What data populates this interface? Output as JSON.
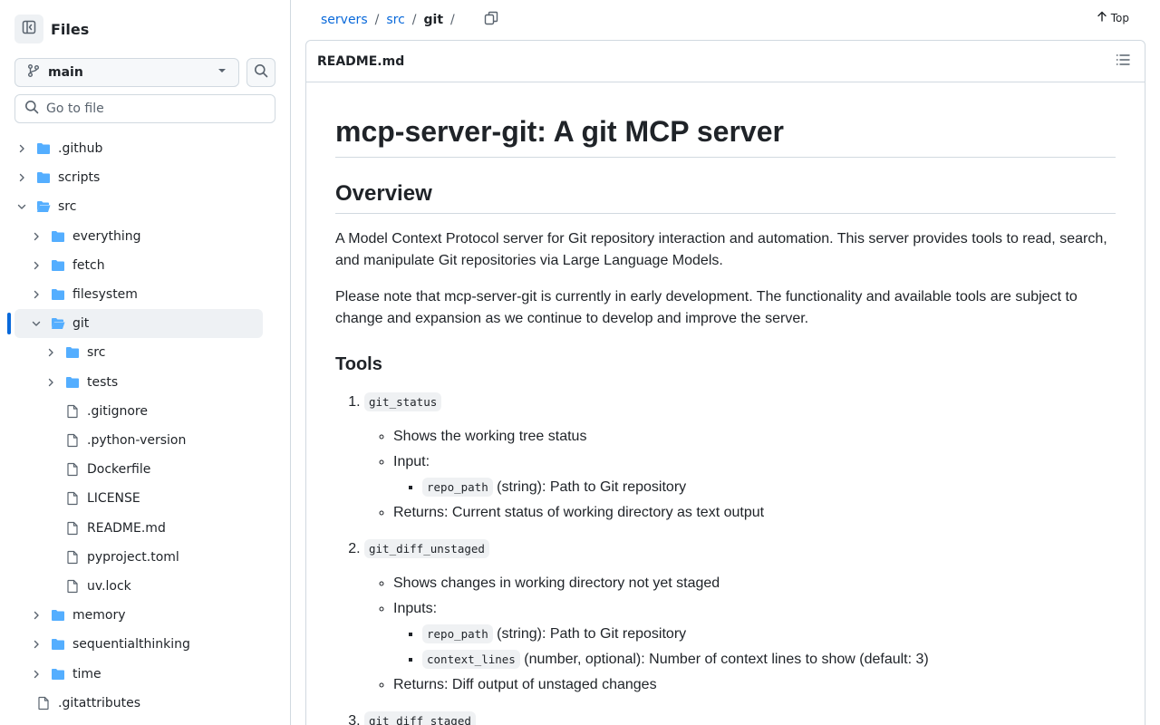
{
  "sidebar": {
    "title": "Files",
    "branch": "main",
    "goto_placeholder": "Go to file",
    "tree": [
      {
        "name": ".github",
        "type": "folder",
        "depth": 0,
        "expanded": false
      },
      {
        "name": "scripts",
        "type": "folder",
        "depth": 0,
        "expanded": false
      },
      {
        "name": "src",
        "type": "folder",
        "depth": 0,
        "expanded": true
      },
      {
        "name": "everything",
        "type": "folder",
        "depth": 1,
        "expanded": false
      },
      {
        "name": "fetch",
        "type": "folder",
        "depth": 1,
        "expanded": false
      },
      {
        "name": "filesystem",
        "type": "folder",
        "depth": 1,
        "expanded": false
      },
      {
        "name": "git",
        "type": "folder",
        "depth": 1,
        "expanded": true,
        "selected": true
      },
      {
        "name": "src",
        "type": "folder",
        "depth": 2,
        "expanded": false
      },
      {
        "name": "tests",
        "type": "folder",
        "depth": 2,
        "expanded": false
      },
      {
        "name": ".gitignore",
        "type": "file",
        "depth": 2
      },
      {
        "name": ".python-version",
        "type": "file",
        "depth": 2
      },
      {
        "name": "Dockerfile",
        "type": "file",
        "depth": 2
      },
      {
        "name": "LICENSE",
        "type": "file",
        "depth": 2
      },
      {
        "name": "README.md",
        "type": "file",
        "depth": 2
      },
      {
        "name": "pyproject.toml",
        "type": "file",
        "depth": 2
      },
      {
        "name": "uv.lock",
        "type": "file",
        "depth": 2
      },
      {
        "name": "memory",
        "type": "folder",
        "depth": 1,
        "expanded": false
      },
      {
        "name": "sequentialthinking",
        "type": "folder",
        "depth": 1,
        "expanded": false
      },
      {
        "name": "time",
        "type": "folder",
        "depth": 1,
        "expanded": false
      },
      {
        "name": ".gitattributes",
        "type": "file",
        "depth": 0
      }
    ]
  },
  "breadcrumb": {
    "items": [
      "servers",
      "src"
    ],
    "current": "git",
    "sep": "/",
    "top_label": "Top"
  },
  "file": {
    "name": "README.md"
  },
  "readme": {
    "h1": "mcp-server-git: A git MCP server",
    "overview_h2": "Overview",
    "p1": "A Model Context Protocol server for Git repository interaction and automation. This server provides tools to read, search, and manipulate Git repositories via Large Language Models.",
    "p2": "Please note that mcp-server-git is currently in early development. The functionality and available tools are subject to change and expansion as we continue to develop and improve the server.",
    "tools_h3": "Tools",
    "tools": [
      {
        "code": "git_status",
        "desc": "Shows the working tree status",
        "input_label": "Input:",
        "inputs": [
          {
            "code": "repo_path",
            "text": " (string): Path to Git repository"
          }
        ],
        "returns": "Returns: Current status of working directory as text output"
      },
      {
        "code": "git_diff_unstaged",
        "desc": "Shows changes in working directory not yet staged",
        "input_label": "Inputs:",
        "inputs": [
          {
            "code": "repo_path",
            "text": " (string): Path to Git repository"
          },
          {
            "code": "context_lines",
            "text": " (number, optional): Number of context lines to show (default: 3)"
          }
        ],
        "returns": "Returns: Diff output of unstaged changes"
      },
      {
        "code": "git_diff_staged"
      }
    ]
  },
  "colors": {
    "accent": "#0969da",
    "folder": "#54aeff",
    "border": "#d1d9e0",
    "muted": "#59636e"
  }
}
